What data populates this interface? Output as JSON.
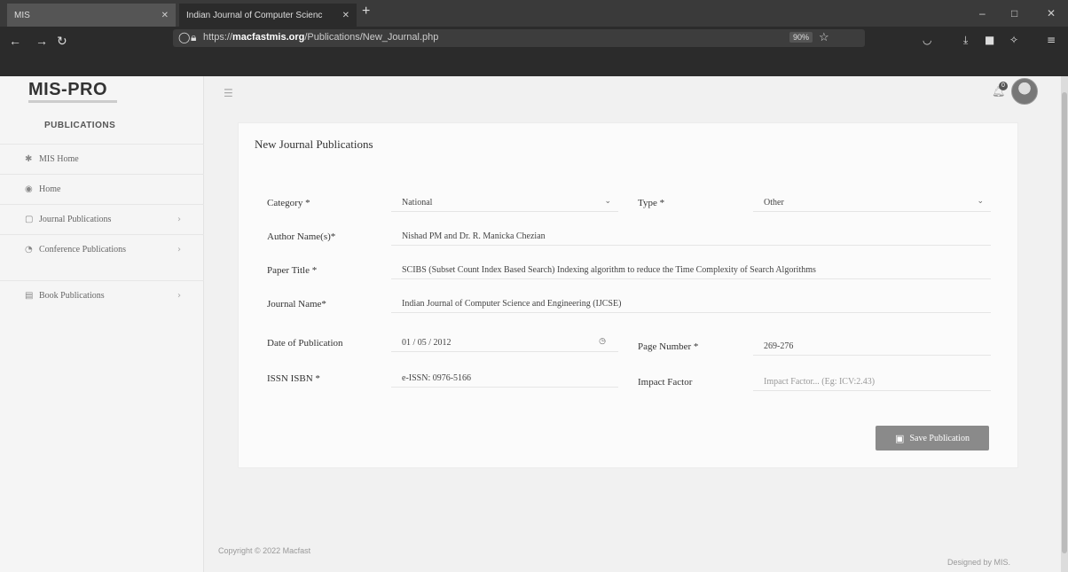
{
  "browser": {
    "tabs": [
      {
        "label": "MIS"
      },
      {
        "label": "Indian Journal of Computer Scienc"
      }
    ],
    "new_tab": "+",
    "url_prefix": "https://",
    "url_domain": "macfastmis.org",
    "url_path": "/Publications/New_Journal.php",
    "zoom": "90%"
  },
  "sidebar": {
    "logo": "MIS-PRO",
    "section_title": "PUBLICATIONS",
    "items": [
      {
        "label": "MIS Home",
        "icon": "home-icon"
      },
      {
        "label": "Home",
        "icon": "dashboard-icon"
      },
      {
        "label": "Journal Publications",
        "icon": "file-icon",
        "has_submenu": true
      },
      {
        "label": "Conference Publications",
        "icon": "globe-icon",
        "has_submenu": true
      },
      {
        "label": "Book Publications",
        "icon": "book-icon",
        "has_submenu": true
      }
    ]
  },
  "header": {
    "notification_count": "0"
  },
  "form": {
    "title": "New Journal Publications",
    "category_label": "Category *",
    "category_value": "National",
    "type_label": "Type *",
    "type_value": "Other",
    "author_label": "Author Name(s)*",
    "author_value": "Nishad PM  and Dr. R. Manicka Chezian",
    "paper_label": "Paper Title *",
    "paper_value": "SCIBS (Subset Count Index Based Search)  Indexing algorithm to reduce the Time Complexity of Search Algorithms",
    "journal_label": "Journal Name*",
    "journal_value": "Indian Journal  of Computer Science and Engineering (IJCSE)",
    "date_label": "Date of Publication",
    "date_value": "01 / 05 / 2012",
    "page_label": "Page Number *",
    "page_value": "269-276",
    "issn_label": "ISSN ISBN *",
    "issn_value": "e-ISSN: 0976-5166",
    "impact_label": "Impact Factor",
    "impact_placeholder": "Impact Factor... (Eg: ICV:2.43)",
    "save_label": "Save Publication"
  },
  "footer": {
    "copyright": "Copyright © 2022 Macfast",
    "designed_by": "Designed by MIS."
  }
}
